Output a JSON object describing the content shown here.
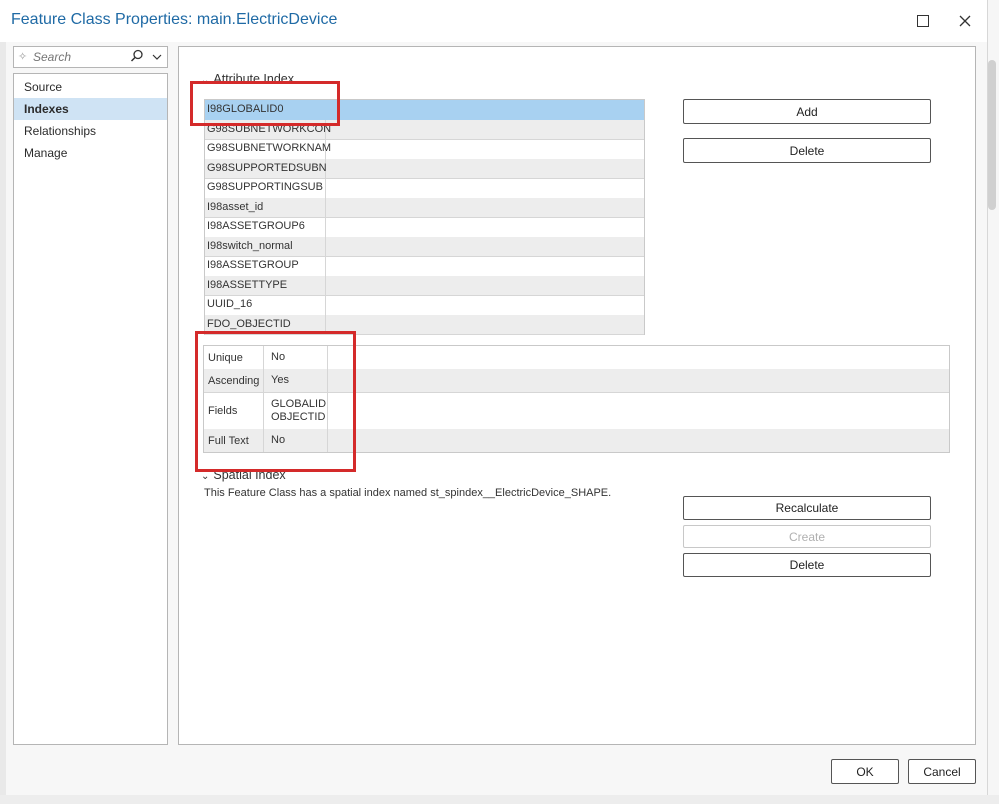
{
  "window": {
    "title": "Feature Class Properties: main.ElectricDevice"
  },
  "search": {
    "placeholder": "Search"
  },
  "nav": {
    "items": [
      {
        "label": "Source"
      },
      {
        "label": "Indexes",
        "selected": true
      },
      {
        "label": "Relationships"
      },
      {
        "label": "Manage"
      }
    ]
  },
  "attribute_index": {
    "heading": "Attribute Index",
    "indexes": [
      "I98GLOBALID0",
      "G98SUBNETWORKCON",
      "G98SUBNETWORKNAM",
      "G98SUPPORTEDSUBN",
      "G98SUPPORTINGSUB",
      "I98asset_id",
      "I98ASSETGROUP6",
      "I98switch_normal",
      "I98ASSETGROUP",
      "I98ASSETTYPE",
      "UUID_16",
      "FDO_OBJECTID"
    ],
    "selected_index": "I98GLOBALID0",
    "add_label": "Add",
    "delete_label": "Delete",
    "properties": [
      {
        "key": "Unique",
        "value": "No"
      },
      {
        "key": "Ascending",
        "value": "Yes"
      },
      {
        "key": "Fields",
        "value": "GLOBALID OBJECTID"
      },
      {
        "key": "Full Text",
        "value": "No"
      }
    ]
  },
  "spatial_index": {
    "heading": "Spatial Index",
    "description": "This Feature Class has a spatial index named st_spindex__ElectricDevice_SHAPE.",
    "recalculate_label": "Recalculate",
    "create_label": "Create",
    "delete_label": "Delete"
  },
  "footer": {
    "ok_label": "OK",
    "cancel_label": "Cancel"
  },
  "colors": {
    "title": "#1f6aa5",
    "selection": "#a8d1f1",
    "annotation": "#d42a2a"
  }
}
